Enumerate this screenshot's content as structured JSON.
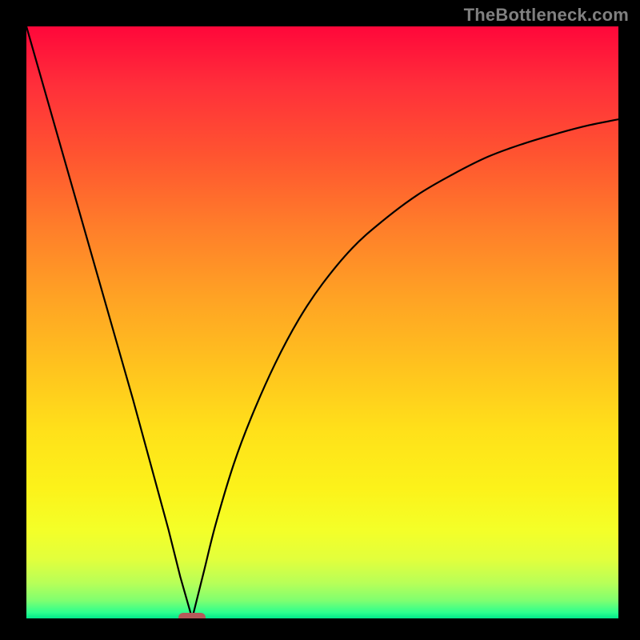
{
  "attribution": "TheBottleneck.com",
  "colors": {
    "frame": "#000000",
    "marker": "#b55a5a",
    "curve": "#000000",
    "gradient_top": "#ff073a",
    "gradient_bottom": "#00e78a"
  },
  "chart_data": {
    "type": "line",
    "title": "",
    "xlabel": "",
    "ylabel": "",
    "xlim": [
      0,
      100
    ],
    "ylim": [
      0,
      100
    ],
    "grid": false,
    "legend": false,
    "description": "V-shaped bottleneck curve with sharp minimum near x≈28; left branch nearly linear from top-left corner, right branch concave approaching ~84% height at right edge.",
    "minimum": {
      "x": 28,
      "y": 0
    },
    "series": [
      {
        "name": "bottleneck-curve",
        "x": [
          0,
          3,
          6,
          9,
          12,
          15,
          18,
          21,
          24,
          26,
          28,
          30,
          32,
          35,
          38,
          42,
          46,
          50,
          55,
          60,
          66,
          72,
          78,
          84,
          90,
          95,
          100
        ],
        "values": [
          100,
          89.5,
          79,
          68.5,
          58,
          47.5,
          37,
          26,
          15,
          7,
          0,
          8,
          16,
          26,
          34,
          43,
          50.5,
          56.5,
          62.5,
          67,
          71.5,
          75,
          78,
          80.2,
          82,
          83.3,
          84.3
        ]
      }
    ],
    "marker": {
      "x": 28,
      "y": 0,
      "w_pct": 4.6,
      "h_pct": 1.6
    }
  }
}
